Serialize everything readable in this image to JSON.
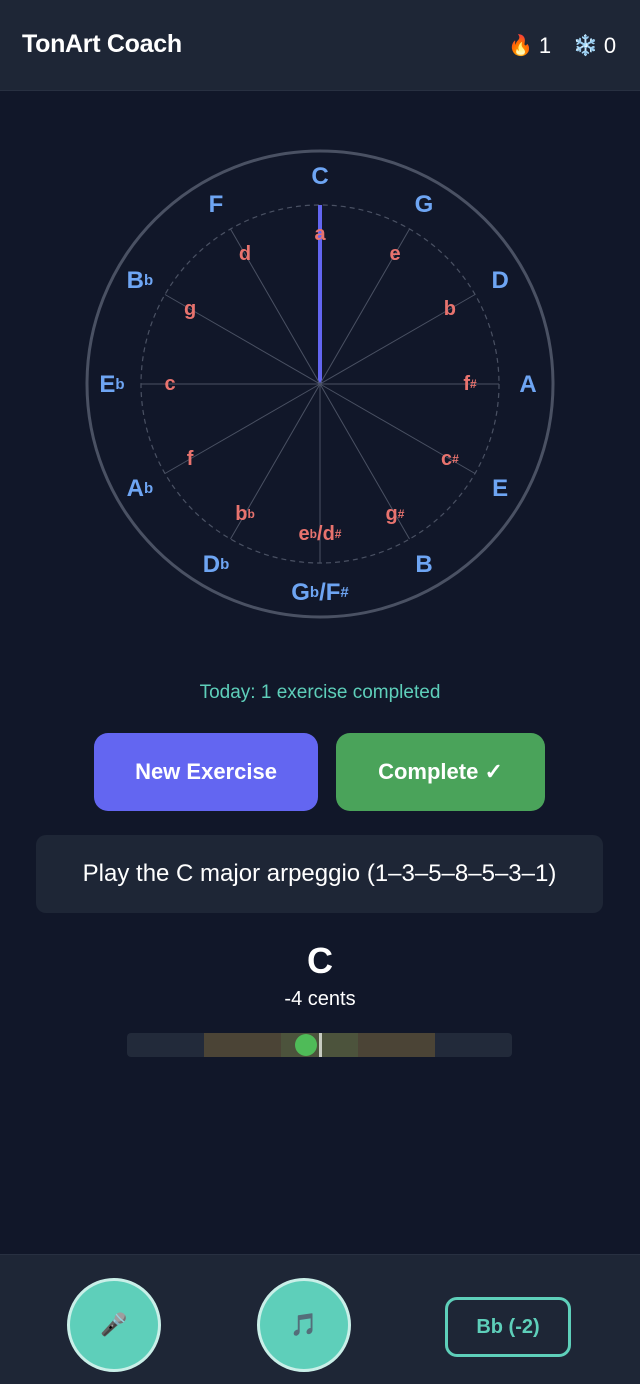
{
  "header": {
    "title": "TonArt Coach",
    "streak_icon": "fire-icon",
    "streak_count": "1",
    "freeze_icon": "snowflake-icon",
    "freeze_count": "0"
  },
  "circle_of_fifths": {
    "highlighted_key": "C",
    "major": [
      {
        "name": "C",
        "base": "C",
        "acc": ""
      },
      {
        "name": "G",
        "base": "G",
        "acc": ""
      },
      {
        "name": "D",
        "base": "D",
        "acc": ""
      },
      {
        "name": "A",
        "base": "A",
        "acc": ""
      },
      {
        "name": "E",
        "base": "E",
        "acc": ""
      },
      {
        "name": "B",
        "base": "B",
        "acc": ""
      },
      {
        "name": "Gb/F#",
        "base": "G",
        "acc": "b",
        "base2": "F",
        "acc2": "#"
      },
      {
        "name": "Db",
        "base": "D",
        "acc": "b"
      },
      {
        "name": "Ab",
        "base": "A",
        "acc": "b"
      },
      {
        "name": "Eb",
        "base": "E",
        "acc": "b"
      },
      {
        "name": "Bb",
        "base": "B",
        "acc": "b"
      },
      {
        "name": "F",
        "base": "F",
        "acc": ""
      }
    ],
    "minor": [
      {
        "name": "a",
        "base": "a",
        "acc": ""
      },
      {
        "name": "e",
        "base": "e",
        "acc": ""
      },
      {
        "name": "b",
        "base": "b",
        "acc": ""
      },
      {
        "name": "f#",
        "base": "f",
        "acc": "#"
      },
      {
        "name": "c#",
        "base": "c",
        "acc": "#"
      },
      {
        "name": "g#",
        "base": "g",
        "acc": "#"
      },
      {
        "name": "eb/d#",
        "base": "e",
        "acc": "b",
        "base2": "d",
        "acc2": "#"
      },
      {
        "name": "bb",
        "base": "b",
        "acc": "b"
      },
      {
        "name": "f",
        "base": "f",
        "acc": ""
      },
      {
        "name": "c",
        "base": "c",
        "acc": ""
      },
      {
        "name": "g",
        "base": "g",
        "acc": ""
      },
      {
        "name": "d",
        "base": "d",
        "acc": ""
      }
    ],
    "colors": {
      "major": "#6ea5f3",
      "minor": "#e8736e",
      "highlight": "#6366f1",
      "lines": "#4a5163"
    }
  },
  "today_text": "Today: 1 exercise completed",
  "buttons": {
    "new_exercise": "New Exercise",
    "complete": "Complete ✓"
  },
  "exercise": {
    "text": "Play the C major arpeggio (1–3–5–8–5–3–1)"
  },
  "tuner": {
    "note": "C",
    "cents_label": "-4 cents",
    "cents_value": -4,
    "range_cents": 50
  },
  "footer": {
    "mic_icon": "microphone-icon",
    "music_icon": "music-note-icon",
    "transpose_label": "Bb (-2)"
  }
}
